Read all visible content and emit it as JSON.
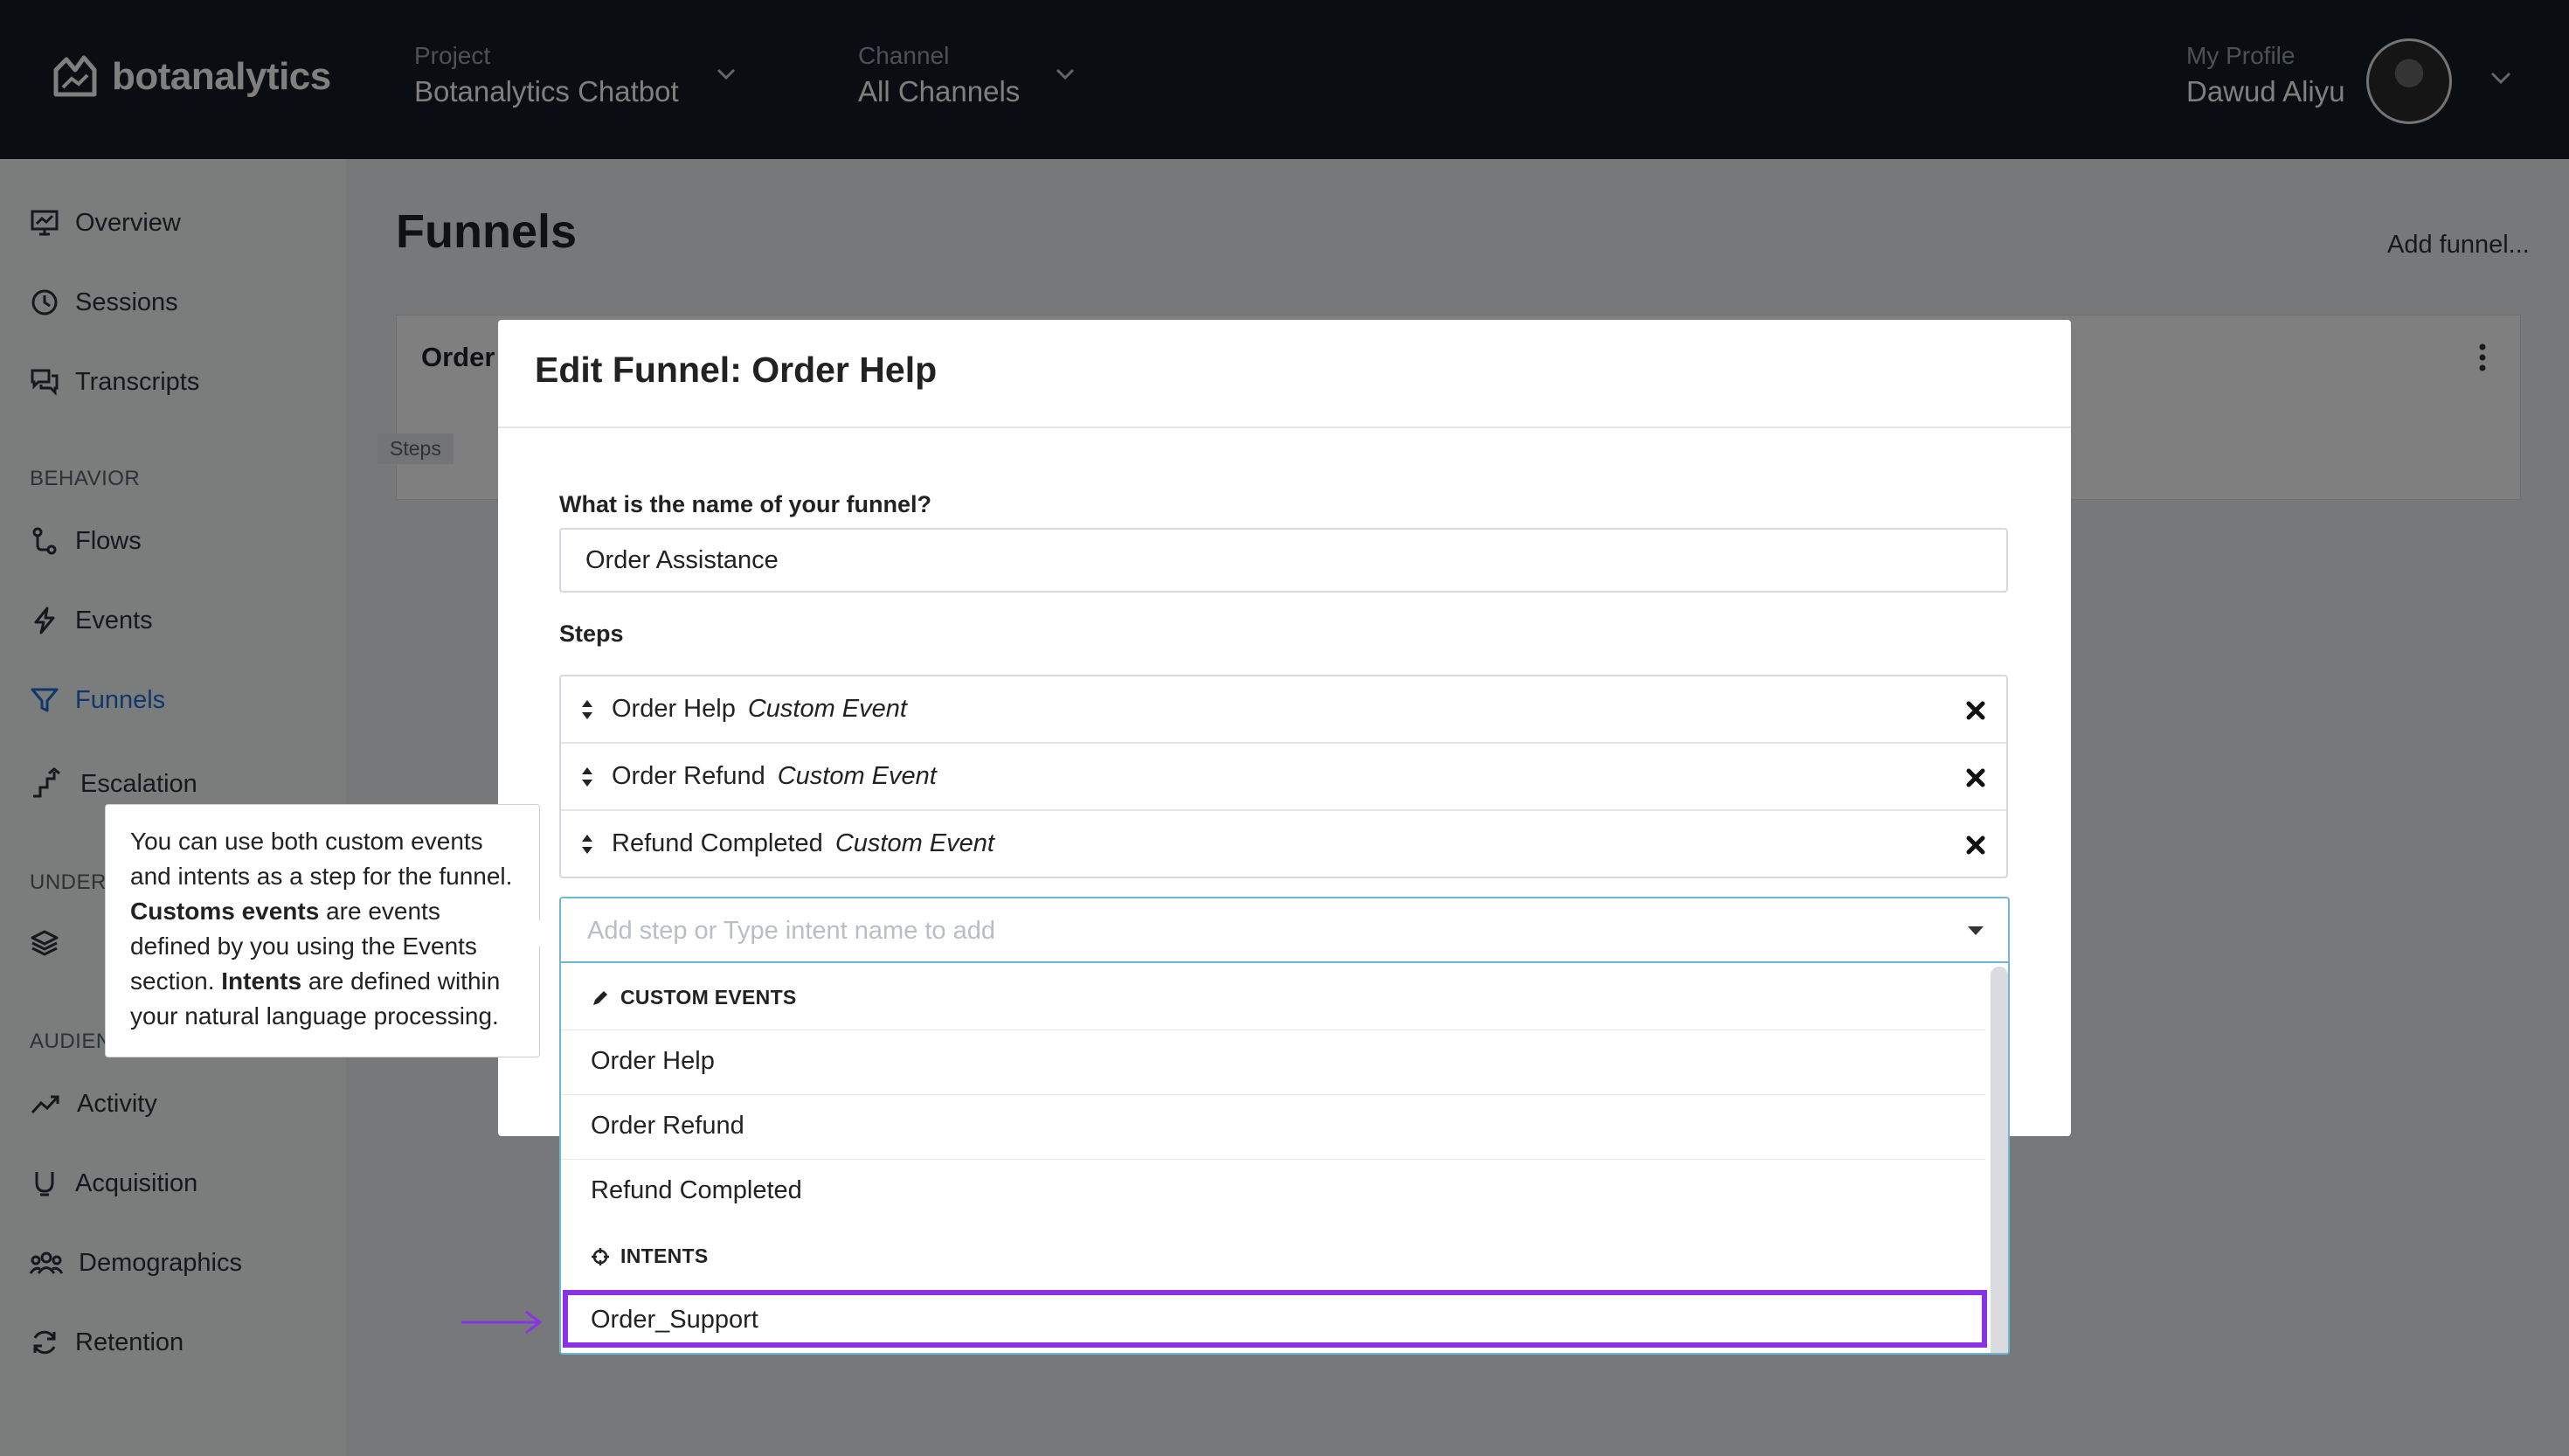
{
  "app": {
    "brand": "botanalytics",
    "project_label": "Project",
    "project_value": "Botanalytics Chatbot",
    "channel_label": "Channel",
    "channel_value": "All Channels",
    "profile_label": "My Profile",
    "profile_name": "Dawud Aliyu"
  },
  "sidebar": {
    "items": [
      {
        "label": "Overview",
        "icon": "chart-board-icon"
      },
      {
        "label": "Sessions",
        "icon": "clock-icon"
      },
      {
        "label": "Transcripts",
        "icon": "chat-bubbles-icon"
      }
    ],
    "behavior_heading": "BEHAVIOR",
    "behavior_items": [
      {
        "label": "Flows",
        "icon": "flow-icon"
      },
      {
        "label": "Events",
        "icon": "lightning-icon"
      },
      {
        "label": "Funnels",
        "icon": "funnel-icon"
      },
      {
        "label": "Escalation",
        "icon": "escalation-icon"
      }
    ],
    "understanding_heading": "UNDER",
    "audience_heading": "AUDIEN",
    "audience_items": [
      {
        "label": "Activity",
        "icon": "trend-icon"
      },
      {
        "label": "Acquisition",
        "icon": "acquisition-icon"
      },
      {
        "label": "Demographics",
        "icon": "users-icon"
      },
      {
        "label": "Retention",
        "icon": "refresh-icon"
      }
    ]
  },
  "page": {
    "title": "Funnels",
    "add_funnel": "Add funnel...",
    "card_title": "Order",
    "steps_chip": "Steps"
  },
  "modal": {
    "title": "Edit Funnel: Order Help",
    "name_label": "What is the name of your funnel?",
    "name_value": "Order Assistance",
    "steps_label": "Steps",
    "steps": [
      {
        "name": "Order Help",
        "type": "Custom Event"
      },
      {
        "name": "Order Refund",
        "type": "Custom Event"
      },
      {
        "name": "Refund Completed",
        "type": "Custom Event"
      }
    ]
  },
  "dropdown": {
    "placeholder": "Add step or Type intent name to add",
    "custom_events_heading": "CUSTOM EVENTS",
    "custom_events": [
      "Order Help",
      "Order Refund",
      "Refund Completed"
    ],
    "intents_heading": "INTENTS",
    "intents": [
      "Order_Support"
    ]
  },
  "tooltip": {
    "line1": "You can use both custom events and intents as a step for the funnel.",
    "bold1": "Customs events",
    "text2": " are events defined by you using the Events section.",
    "bold2": "Intents",
    "text3": " are defined within your natural language processing."
  },
  "colors": {
    "topbar": "#151b25",
    "active_nav": "#1e6fd9",
    "highlight": "#8a33e6",
    "select_border": "#6fb6d2"
  }
}
